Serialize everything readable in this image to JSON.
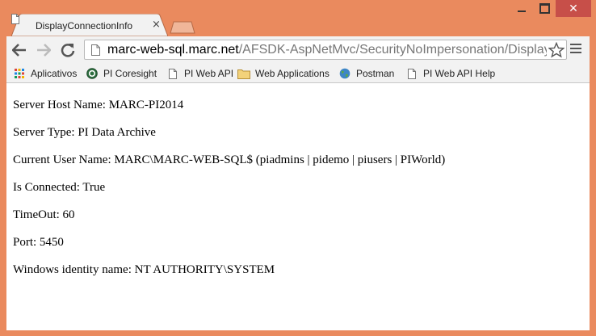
{
  "window": {
    "controls": {
      "minimize": "—",
      "maximize": "□",
      "close": "✕"
    }
  },
  "tab": {
    "title": "DisplayConnectionInfo",
    "close_glyph": "×"
  },
  "toolbar": {
    "url_host": "marc-web-sql.marc.net",
    "url_path": "/AFSDK-AspNetMvc/SecurityNoImpersonation/DisplayF"
  },
  "bookmarks": {
    "items": [
      {
        "label": "Aplicativos",
        "icon": "apps-grid-icon"
      },
      {
        "label": "PI Coresight",
        "icon": "coresight-icon"
      },
      {
        "label": "PI Web API",
        "icon": "page-icon"
      },
      {
        "label": "Web Applications",
        "icon": "folder-icon"
      },
      {
        "label": "Postman",
        "icon": "globe-icon"
      },
      {
        "label": "PI Web API Help",
        "icon": "page-icon"
      }
    ]
  },
  "content": {
    "lines": [
      "Server Host Name: MARC-PI2014",
      "Server Type: PI Data Archive",
      "Current User Name: MARC\\MARC-WEB-SQL$ (piadmins | pidemo | piusers | PIWorld)",
      "Is Connected: True",
      "TimeOut: 60",
      "Port: 5450",
      "Windows identity name: NT AUTHORITY\\SYSTEM"
    ]
  },
  "colors": {
    "frame": "#ea8a5e",
    "close_button": "#c74f49",
    "toolbar": "#f2f2f2"
  }
}
